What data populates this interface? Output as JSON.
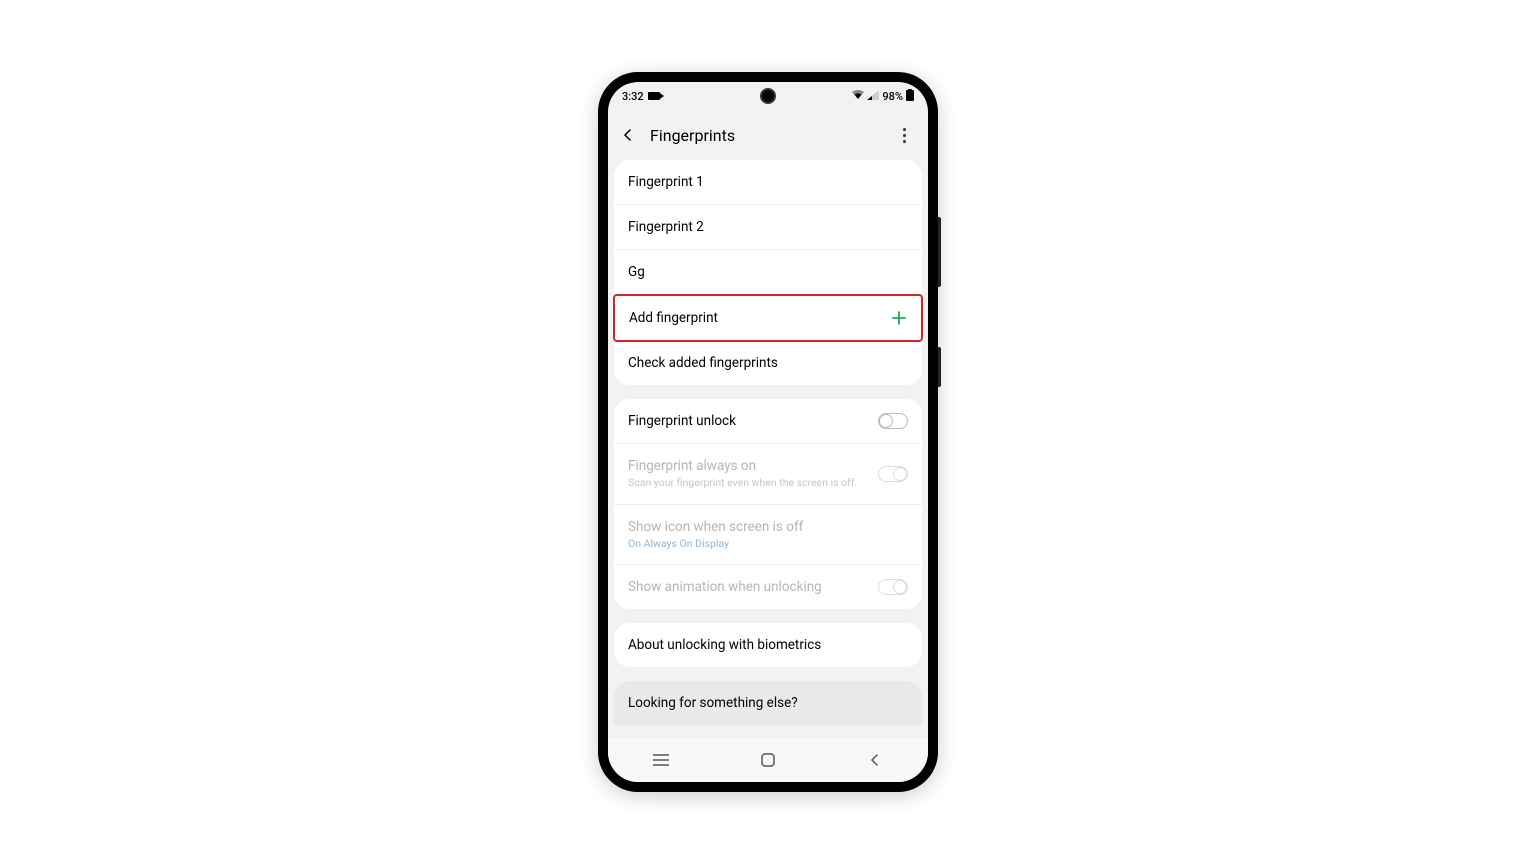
{
  "status": {
    "time": "3:32",
    "battery": "98%"
  },
  "header": {
    "title": "Fingerprints"
  },
  "section1": {
    "items": [
      "Fingerprint 1",
      "Fingerprint 2",
      "Gg"
    ],
    "add_label": "Add fingerprint",
    "check_label": "Check added fingerprints"
  },
  "section2": {
    "unlock_label": "Fingerprint unlock",
    "always_on_label": "Fingerprint always on",
    "always_on_sub": "Scan your fingerprint even when the screen is off.",
    "show_icon_label": "Show icon when screen is off",
    "show_icon_sub": "On Always On Display",
    "show_anim_label": "Show animation when unlocking"
  },
  "section3": {
    "about_label": "About unlocking with biometrics"
  },
  "footer": {
    "looking_label": "Looking for something else?"
  }
}
